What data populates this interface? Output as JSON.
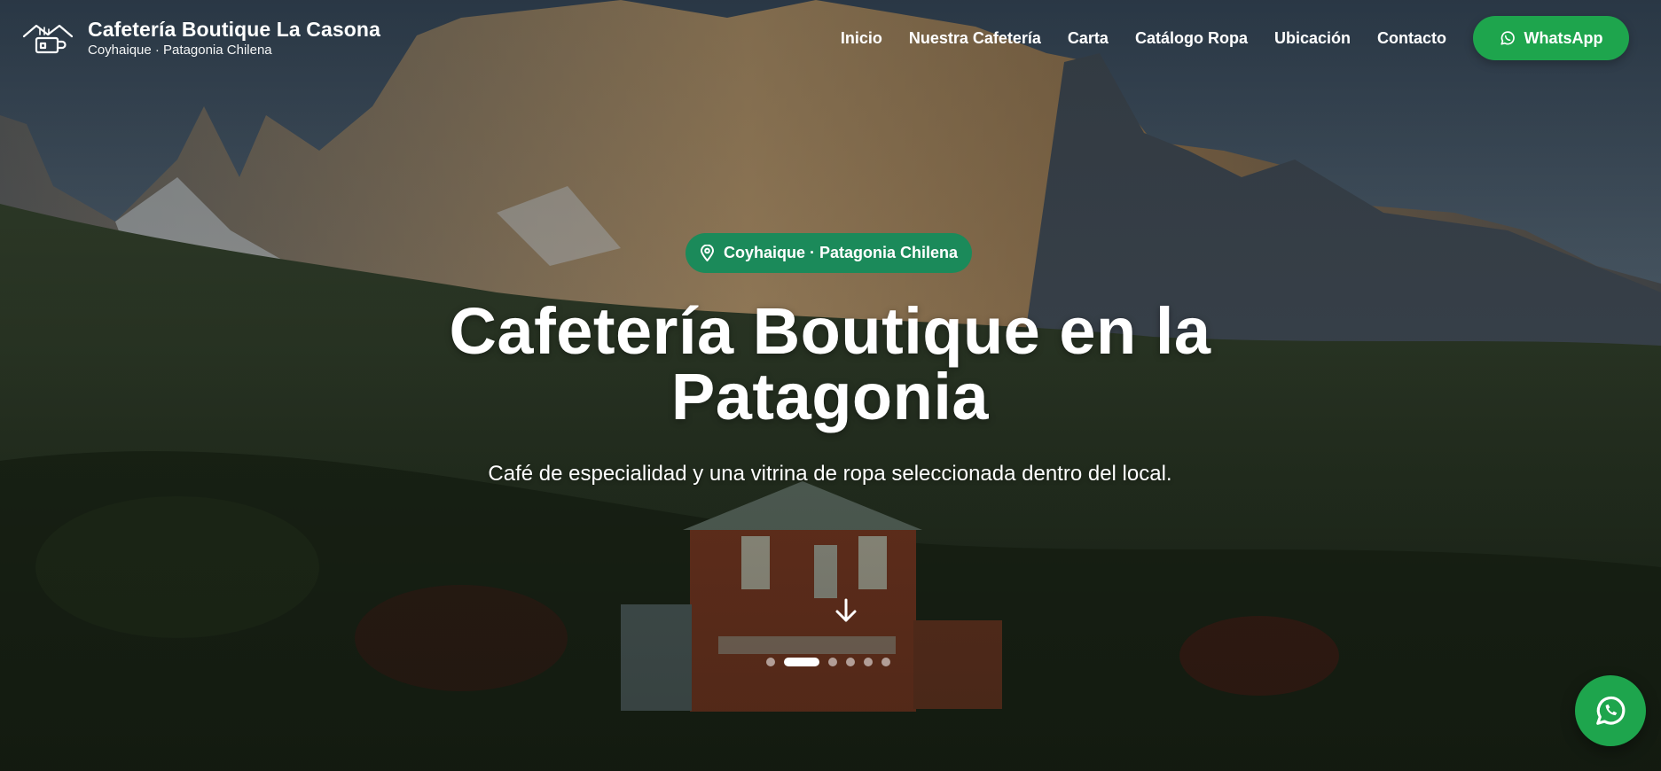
{
  "brand": {
    "title": "Cafetería Boutique La Casona",
    "subtitle": "Coyhaique · Patagonia Chilena",
    "logo_icon": "house-coffee-logo-icon"
  },
  "nav": {
    "items": [
      {
        "label": "Inicio"
      },
      {
        "label": "Nuestra Cafetería"
      },
      {
        "label": "Carta"
      },
      {
        "label": "Catálogo Ropa"
      },
      {
        "label": "Ubicación"
      },
      {
        "label": "Contacto"
      }
    ],
    "cta_label": "WhatsApp",
    "cta_icon": "whatsapp-icon"
  },
  "hero": {
    "badge_label": "Coyhaique · Patagonia Chilena",
    "badge_icon": "location-pin-icon",
    "title_line1": "Cafetería Boutique en la",
    "title_line2": "Patagonia",
    "subtitle": "Café de especialidad y una vitrina de ropa seleccionada dentro del local.",
    "scroll_icon": "arrow-down-icon",
    "slides_total": 6,
    "slide_active": 2
  },
  "colors": {
    "accent_green": "#1ea54d",
    "badge_green": "#1b8a5a"
  }
}
